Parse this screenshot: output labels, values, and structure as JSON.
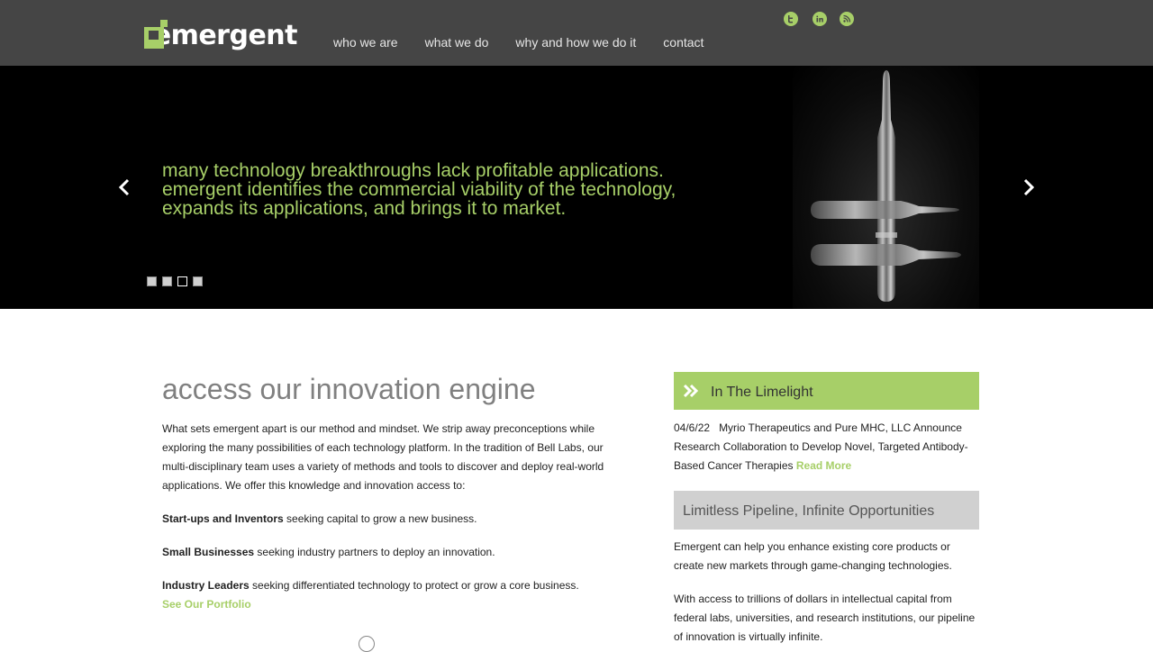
{
  "brand": {
    "name": "emergent"
  },
  "nav": {
    "items": [
      "who we are",
      "what we do",
      "why and how we do it",
      "contact"
    ]
  },
  "social": {
    "twitter": "t",
    "linkedin": "in",
    "rss": "r"
  },
  "hero": {
    "lines": [
      "many technology breakthroughs lack profitable applications.",
      "emergent identifies the commercial viability of the technology,",
      "expands its applications, and brings it to market."
    ],
    "prev_icon": "chevron-left-icon",
    "next_icon": "chevron-right-icon",
    "slides": 4,
    "active_slide": 3
  },
  "main": {
    "title": "access our innovation engine",
    "intro": "What sets emergent apart is our method and mindset. We strip away preconceptions while exploring the many possibilities of each technology platform. In the tradition of Bell Labs, our multi-disciplinary team uses a variety of methods and tools to discover and deploy real-world applications. We offer this knowledge and innovation access to:",
    "segments": [
      {
        "label": "Start-ups and Inventors",
        "text": " seeking capital to grow a new business."
      },
      {
        "label": "Small Businesses",
        "text": " seeking industry partners to deploy an innovation."
      },
      {
        "label": "Industry Leaders",
        "text": " seeking differentiated technology to protect or grow a core business."
      }
    ],
    "portfolio_link": "See Our Portfolio"
  },
  "limelight": {
    "title": "In The Limelight",
    "icon": "double-chevron-icon",
    "date": "04/6/22",
    "headline": "Myrio Therapeutics and Pure MHC, LLC Announce Research Collaboration to Develop Novel, Targeted Antibody-Based Cancer Therapies",
    "read_more": "Read More"
  },
  "pipeline": {
    "title": "Limitless Pipeline, Infinite Opportunities",
    "p1": "Emergent can help you enhance existing core products or create new markets through game-changing technologies.",
    "p2": "With access to trillions of dollars in intellectual capital from federal labs, universities, and research institutions, our pipeline of innovation is virtually infinite."
  },
  "colors": {
    "accent": "#a7cf68",
    "topbar": "#454545",
    "grey_box": "#d0d0d0"
  }
}
